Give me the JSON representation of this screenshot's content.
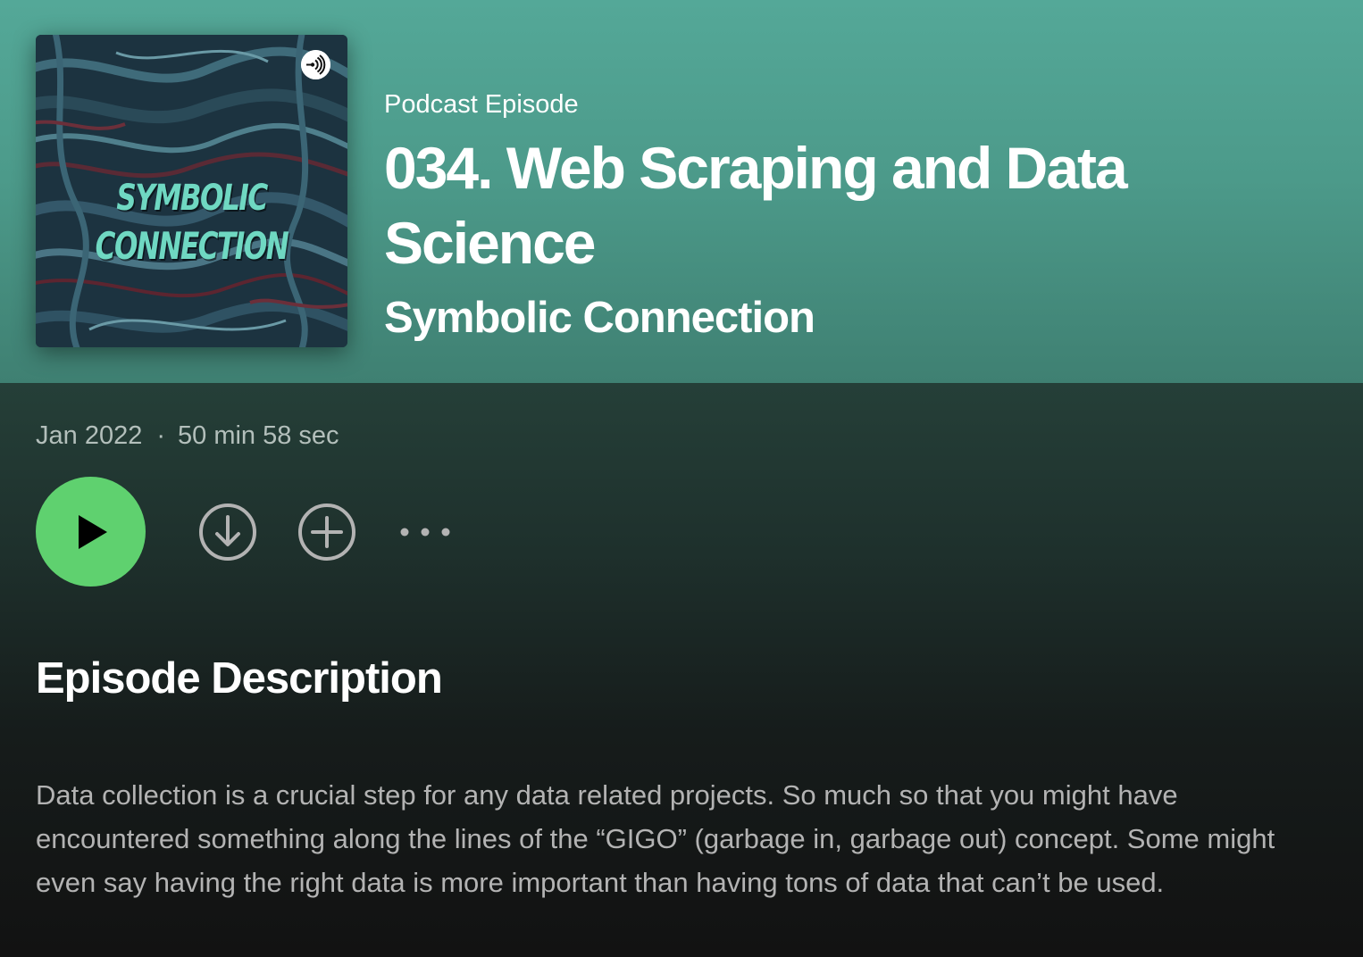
{
  "episode": {
    "type_label": "Podcast Episode",
    "title": "034. Web Scraping and Data Science",
    "show_name": "Symbolic Connection",
    "cover": {
      "line1": "SYMBOLIC",
      "line2": "CONNECTION",
      "text_color": "#6fd8c2"
    }
  },
  "meta": {
    "date": "Jan 2022",
    "separator": "·",
    "duration": "50 min 58 sec"
  },
  "actions": {
    "play_icon": "play-icon",
    "download_icon": "download-icon",
    "add_icon": "add-icon",
    "more_icon": "more-icon",
    "accent_color": "#5fd16f"
  },
  "description": {
    "heading": "Episode Description",
    "text": "Data collection is a crucial step for any data related projects. So much so that you might have encountered something along the lines of the “GIGO” (garbage in, garbage out) concept. Some might even say having the right data is more important than having tons of data that can’t be used."
  },
  "colors": {
    "header_background": "#4c9a8a",
    "page_background": "#121212"
  }
}
